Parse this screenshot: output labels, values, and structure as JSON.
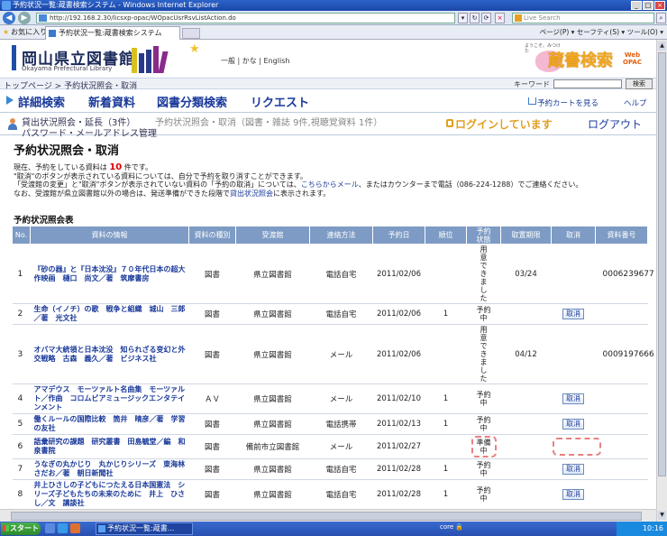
{
  "window": {
    "title": "予約状況一覧:蔵書検索システム - Windows Internet Explorer"
  },
  "browser": {
    "url": "http://192.168.2.30/licsxp-opac/WOpacUsrRsvListAction.do",
    "search_placeholder": "Live Search",
    "favorites": "お気に入り",
    "tab_title": "予約状況一覧:蔵書検索システム",
    "tools": "ページ(P) ▾  セーフティ(S) ▾  ツール(O) ▾"
  },
  "header": {
    "library_name": "岡山県立図書館",
    "library_sub": "Okayama Prefectural Library",
    "lang_links": "一般 | かな | English",
    "mascot_tag": "ようこそ。みつけた",
    "opac_title": "蔵書検索",
    "opac_web": "Web",
    "opac_opac": "OPAC"
  },
  "breadcrumb": {
    "text": "トップページ > 予約状況照会・取消",
    "keyword_label": "キーワード",
    "search_btn": "検索"
  },
  "menu": {
    "items": [
      "詳細検索",
      "新着資料",
      "図書分類検索",
      "リクエスト"
    ],
    "cart": "予約カートを見る",
    "help": "ヘルプ"
  },
  "submenu": {
    "loan": "貸出状況照会・延長（3件）",
    "reserve": "予約状況照会・取消（図書・雑誌 9件,視聴覚資料 1件）",
    "password": "パスワード・メールアドレス管理",
    "logged_in": "ログインしています",
    "logout": "ログアウト"
  },
  "page": {
    "title": "予約状況照会・取消",
    "info_pre": "現在、予約をしている資料は",
    "info_count": "10",
    "info_post": "件です。",
    "info2": "\"取消\"のボタンが表示されている資料については、自分で予約を取り消すことができます。",
    "info3a": "「受渡館の変更」と\"取消\"ボタンが表示されていない資料の「予約の取消」については、",
    "info3_link": "こちらからメール",
    "info3b": "、またはカウンターまで電話（086-224-1288）でご連絡ください。",
    "info4a": "なお、受渡館が県立図書館以外の場合は、発送準備ができた段階で",
    "info4_link": "貸出状況照会",
    "info4b": "に表示されます。",
    "table_caption": "予約状況照会表"
  },
  "table": {
    "headers": [
      "No.",
      "資料の情報",
      "資料の種別",
      "受渡館",
      "連絡方法",
      "予約日",
      "順位",
      "予約\n状態",
      "取置期限",
      "取消",
      "資料番号"
    ],
    "cancel_label": "取消",
    "rows": [
      {
        "no": "1",
        "title": "『砂の器』と『日本沈没』７０年代日本の超大作映画　樋口　尚文／著　筑摩書房",
        "type": "図書",
        "lib": "県立図書館",
        "contact": "電話自宅",
        "date": "2011/02/06",
        "rank": "",
        "status": "用\n意\nで\nき\nま\nし\nた",
        "hold": "03/24",
        "cancel": false,
        "item": "0006239677",
        "dash": false
      },
      {
        "no": "2",
        "title": "生命（イノチ）の歌　戦争と組織　城山　三郎／著　光文社",
        "type": "図書",
        "lib": "県立図書館",
        "contact": "電話自宅",
        "date": "2011/02/06",
        "rank": "1",
        "status": "予約\n中",
        "hold": "",
        "cancel": true,
        "item": "",
        "dash": false
      },
      {
        "no": "3",
        "title": "オバマ大統領と日本沈没　知られざる变幻と外交戦略　古森　義久／著　ビジネス社",
        "type": "図書",
        "lib": "県立図書館",
        "contact": "メール",
        "date": "2011/02/06",
        "rank": "",
        "status": "用\n意\nで\nき\nま\nし\nた",
        "hold": "04/12",
        "cancel": false,
        "item": "0009197666",
        "dash": false
      },
      {
        "no": "4",
        "title": "アマデウス　モーツァルト名曲集　モーツァルト／作曲　コロムビアミュージックエンタテインメント",
        "type": "ＡＶ",
        "lib": "県立図書館",
        "contact": "メール",
        "date": "2011/02/10",
        "rank": "1",
        "status": "予約\n中",
        "hold": "",
        "cancel": true,
        "item": "",
        "dash": false
      },
      {
        "no": "5",
        "title": "働くルールの国際比較　筒井　晴彦／著　学習の友社",
        "type": "図書",
        "lib": "県立図書館",
        "contact": "電話携帯",
        "date": "2011/02/13",
        "rank": "1",
        "status": "予約\n中",
        "hold": "",
        "cancel": true,
        "item": "",
        "dash": false
      },
      {
        "no": "6",
        "title": "語彙研究の課題　研究叢書　田島毓堂／編　和泉書院",
        "type": "図書",
        "lib": "備前市立図書館",
        "contact": "メール",
        "date": "2011/02/27",
        "rank": "",
        "status": "準備\n中",
        "hold": "",
        "cancel": false,
        "item": "",
        "dash": true
      },
      {
        "no": "7",
        "title": "うなぎの丸かじり　丸かじりシリーズ　東海林　さだお／著　朝日新聞社",
        "type": "図書",
        "lib": "県立図書館",
        "contact": "電話自宅",
        "date": "2011/02/28",
        "rank": "1",
        "status": "予約\n中",
        "hold": "",
        "cancel": true,
        "item": "",
        "dash": false
      },
      {
        "no": "8",
        "title": "井上ひさしの子どもにつたえる日本国憲法　シリーズ子どもたちの未来のために　井上　ひさし／文　講談社",
        "type": "図書",
        "lib": "県立図書館",
        "contact": "電話自宅",
        "date": "2011/02/28",
        "rank": "1",
        "status": "予約\n中",
        "hold": "",
        "cancel": true,
        "item": "",
        "dash": false
      },
      {
        "no": "9",
        "title": "アフガニスタンで考える　カラー版岩波ブックレット　中村　哲／［著］　岩波書店",
        "type": "図書",
        "lib": "県立図書館",
        "contact": "電話自宅",
        "date": "2011/03/08",
        "rank": "1",
        "status": "予約\n中",
        "hold": "",
        "cancel": true,
        "item": "",
        "dash": false
      },
      {
        "no": "10",
        "title": "月下の恋人　浅田　次郎／著　光文社",
        "type": "図書",
        "lib": "県立図書館",
        "contact": "電話自宅",
        "date": "2011/03/08",
        "rank": "3",
        "status": "予約\n中",
        "hold": "",
        "cancel": true,
        "item": "",
        "dash": false
      }
    ]
  },
  "taskbar": {
    "start": "スタート",
    "task": "予約状況一覧:蔵書...",
    "clock": "10:16",
    "status_icons": "core 🔒"
  },
  "colors": {
    "header_blue": "#7d9bc4",
    "link": "#1a3a9a",
    "accent_orange": "#e0a020",
    "dash_pink": "#e88080"
  }
}
